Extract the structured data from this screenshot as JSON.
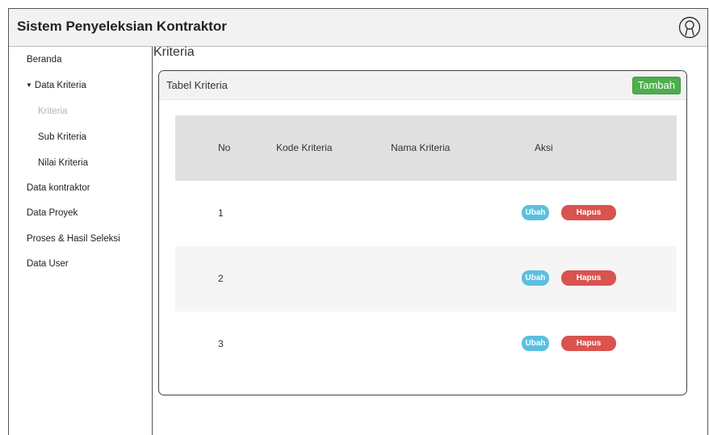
{
  "header": {
    "title": "Sistem Penyeleksian Kontraktor",
    "user_icon": "user-circle-icon"
  },
  "sidebar": {
    "items": [
      {
        "label": "Beranda"
      },
      {
        "label": "Data Kriteria",
        "expanded": true,
        "caret": "▼"
      },
      {
        "label": "Kriteria",
        "active": true
      },
      {
        "label": "Sub Kriteria"
      },
      {
        "label": "Nilai Kriteria"
      },
      {
        "label": "Data kontraktor"
      },
      {
        "label": "Data Proyek"
      },
      {
        "label": "Proses & Hasil Seleksi"
      },
      {
        "label": "Data User"
      }
    ]
  },
  "main": {
    "page_title": "Kriteria",
    "panel_title": "Tabel Kriteria",
    "add_button": "Tambah",
    "table": {
      "headers": [
        "No",
        "Kode Kriteria",
        "Nama Kriteria",
        "Aksi"
      ],
      "rows": [
        {
          "no": "1",
          "kode": "",
          "nama": "",
          "edit": "Ubah",
          "delete": "Hapus"
        },
        {
          "no": "2",
          "kode": "",
          "nama": "",
          "edit": "Ubah",
          "delete": "Hapus"
        },
        {
          "no": "3",
          "kode": "",
          "nama": "",
          "edit": "Ubah",
          "delete": "Hapus"
        }
      ]
    }
  },
  "colors": {
    "add": "#4cae4c",
    "edit": "#5bc0de",
    "delete": "#d9534f",
    "header_bg": "#f2f2f2",
    "table_head_bg": "#e0e0e0"
  }
}
